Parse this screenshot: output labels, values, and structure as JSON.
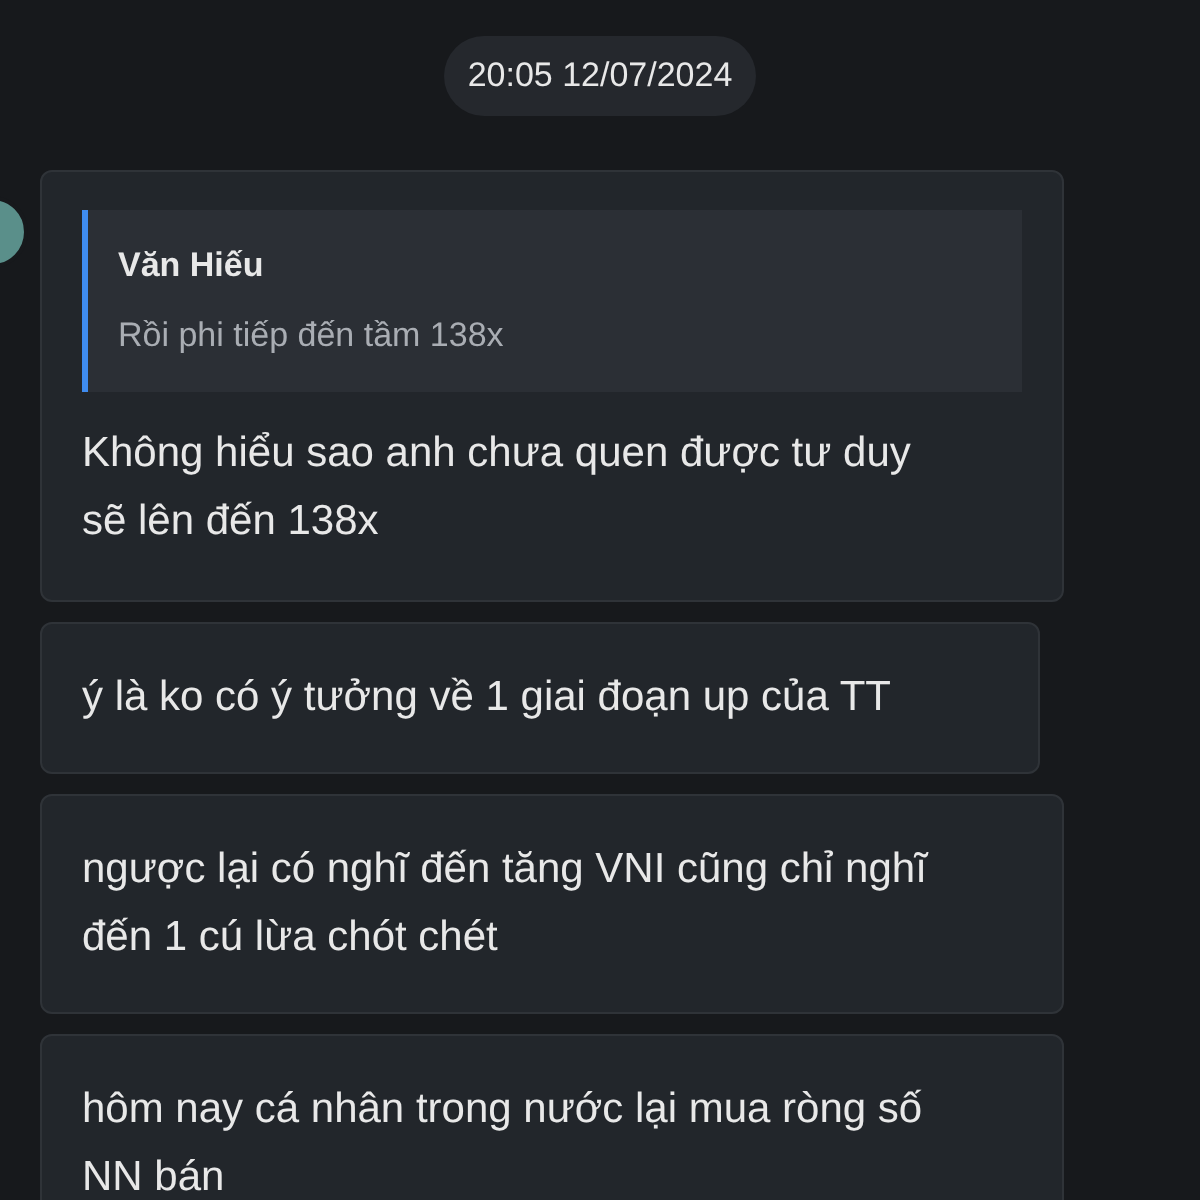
{
  "timestamp": "20:05 12/07/2024",
  "messages": [
    {
      "kind": "reply",
      "quote": {
        "author": "Văn Hiếu",
        "text": "Rồi phi tiếp đến tầm 138x"
      },
      "text": "Không hiểu sao anh chưa quen được tư duy sẽ lên đến 138x"
    },
    {
      "kind": "plain",
      "text": "ý là ko có ý tưởng về 1 giai đoạn up của TT"
    },
    {
      "kind": "plain",
      "text": "ngược lại có nghĩ đến tăng VNI cũng chỉ nghĩ đến 1 cú lừa chót chét"
    },
    {
      "kind": "plain",
      "text": "hôm nay cá nhân trong nước lại mua ròng số NN bán"
    }
  ]
}
